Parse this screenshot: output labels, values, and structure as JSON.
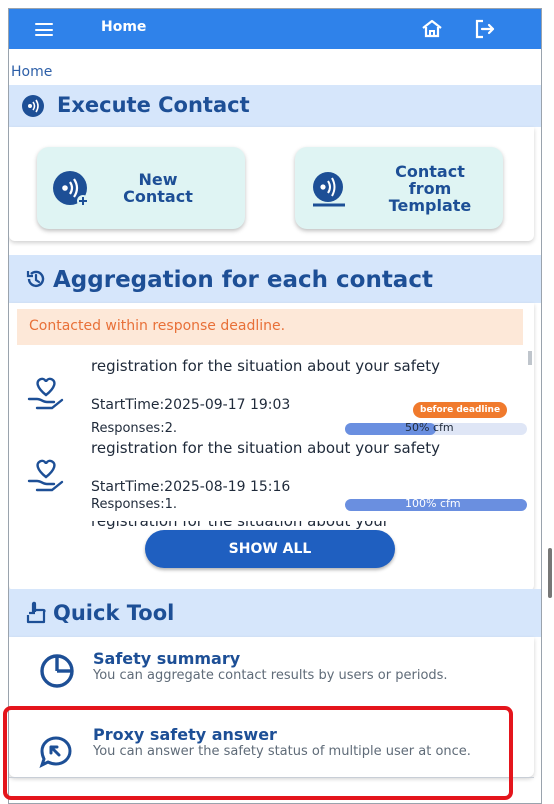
{
  "header": {
    "title": "Home"
  },
  "breadcrumb": "Home",
  "execute": {
    "heading": "Execute Contact",
    "new_contact": "New\nContact",
    "from_template": "Contact\nfrom\nTemplate"
  },
  "aggregation": {
    "heading": "Aggregation for each contact",
    "alert": "Contacted within response deadline.",
    "items": [
      {
        "title": "registration for the situation about your safety",
        "start": "StartTime:2025-09-17 19:03",
        "responses": "Responses:2.",
        "badge": "before deadline",
        "progress_label": "50% cfm",
        "progress": 0.5
      },
      {
        "title": "registration for the situation about your safety",
        "start": "StartTime:2025-08-19 15:16",
        "responses": "Responses:1.",
        "badge": "",
        "progress_label": "100% cfm",
        "progress": 1.0
      }
    ],
    "partial_item_title": "registration for the situation about your",
    "show_all": "SHOW ALL"
  },
  "quick_tool": {
    "heading": "Quick Tool",
    "items": [
      {
        "title": "Safety summary",
        "desc": "You can aggregate contact results by users or periods."
      },
      {
        "title": "Proxy safety answer",
        "desc": "You can answer the safety status of multiple user at once."
      }
    ]
  },
  "colors": {
    "header_bg": "#2f82ea",
    "section_bg": "#d6e6fb",
    "accent_text": "#1d4f96",
    "alert_bg": "#fde8d8",
    "alert_text": "#e87038",
    "badge": "#f07a2d",
    "highlight": "#e4151c"
  },
  "icons": [
    "menu-icon",
    "home-icon",
    "logout-icon",
    "broadcast-icon",
    "history-icon",
    "heart-hand-icon",
    "hand-pointer-icon",
    "pie-chart-icon",
    "proxy-answer-icon"
  ]
}
